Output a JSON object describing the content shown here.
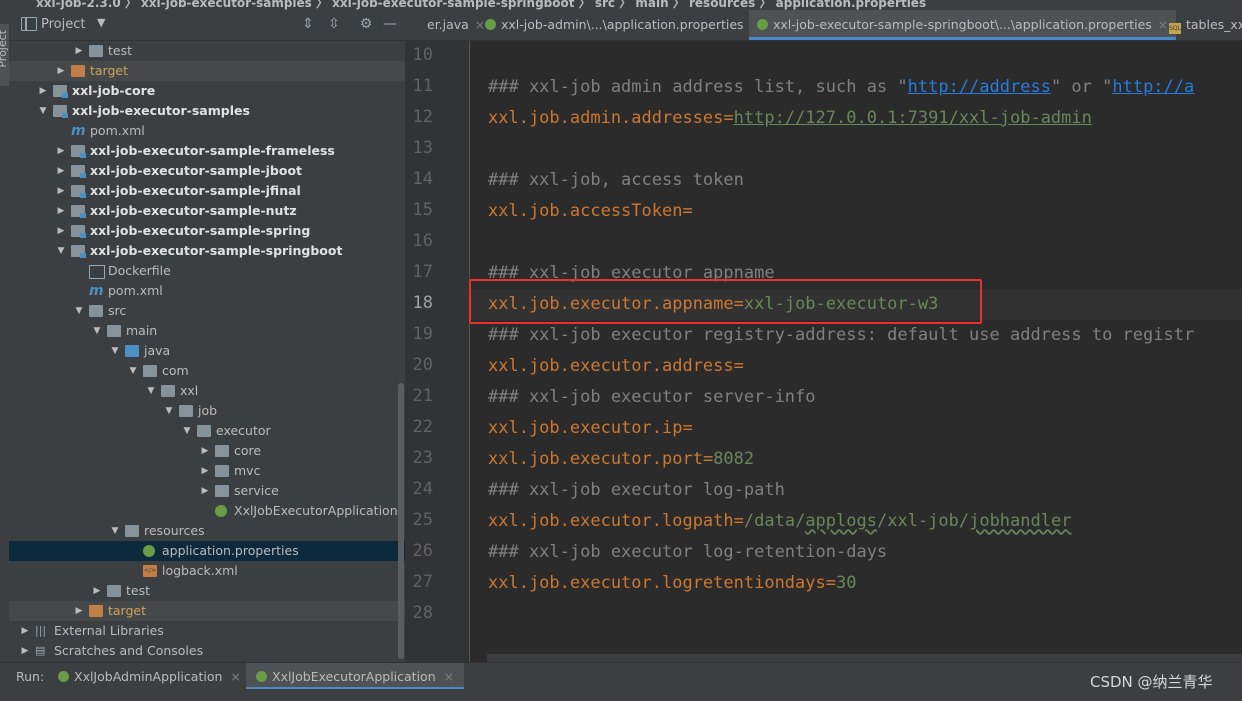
{
  "top_breadcrumb": "xxl-job-2.3.0  〉 xxl-job-executor-samples 〉 xxl-job-executor-sample-springboot 〉 src 〉 main 〉 resources 〉 application.properties",
  "left_tool": {
    "label": "Project"
  },
  "project_panel": {
    "title": "Project",
    "caret": "▼",
    "tree": [
      {
        "label": "test",
        "depth": 3,
        "tri": "▶",
        "icon": "folder",
        "style": "normal"
      },
      {
        "label": "target",
        "depth": 2,
        "tri": "▶",
        "icon": "folder-orange",
        "style": "orange",
        "dim": true
      },
      {
        "label": "xxl-job-core",
        "depth": 1,
        "tri": "▶",
        "icon": "module",
        "style": "bold"
      },
      {
        "label": "xxl-job-executor-samples",
        "depth": 1,
        "tri": "▼",
        "icon": "module",
        "style": "bold"
      },
      {
        "label": "pom.xml",
        "depth": 2,
        "tri": "",
        "icon": "maven",
        "style": "normal"
      },
      {
        "label": "xxl-job-executor-sample-frameless",
        "depth": 2,
        "tri": "▶",
        "icon": "module",
        "style": "bold"
      },
      {
        "label": "xxl-job-executor-sample-jboot",
        "depth": 2,
        "tri": "▶",
        "icon": "module",
        "style": "bold"
      },
      {
        "label": "xxl-job-executor-sample-jfinal",
        "depth": 2,
        "tri": "▶",
        "icon": "module",
        "style": "bold"
      },
      {
        "label": "xxl-job-executor-sample-nutz",
        "depth": 2,
        "tri": "▶",
        "icon": "module",
        "style": "bold"
      },
      {
        "label": "xxl-job-executor-sample-spring",
        "depth": 2,
        "tri": "▶",
        "icon": "module",
        "style": "bold"
      },
      {
        "label": "xxl-job-executor-sample-springboot",
        "depth": 2,
        "tri": "▼",
        "icon": "module",
        "style": "bold"
      },
      {
        "label": "Dockerfile",
        "depth": 3,
        "tri": "",
        "icon": "docker",
        "style": "normal"
      },
      {
        "label": "pom.xml",
        "depth": 3,
        "tri": "",
        "icon": "maven",
        "style": "normal"
      },
      {
        "label": "src",
        "depth": 3,
        "tri": "▼",
        "icon": "folder",
        "style": "normal"
      },
      {
        "label": "main",
        "depth": 4,
        "tri": "▼",
        "icon": "folder",
        "style": "normal"
      },
      {
        "label": "java",
        "depth": 5,
        "tri": "▼",
        "icon": "folder-blue",
        "style": "normal"
      },
      {
        "label": "com",
        "depth": 6,
        "tri": "▼",
        "icon": "package",
        "style": "normal"
      },
      {
        "label": "xxl",
        "depth": 7,
        "tri": "▼",
        "icon": "package",
        "style": "normal"
      },
      {
        "label": "job",
        "depth": 8,
        "tri": "▼",
        "icon": "package",
        "style": "normal"
      },
      {
        "label": "executor",
        "depth": 9,
        "tri": "▼",
        "icon": "package",
        "style": "normal"
      },
      {
        "label": "core",
        "depth": 10,
        "tri": "▶",
        "icon": "package",
        "style": "normal"
      },
      {
        "label": "mvc",
        "depth": 10,
        "tri": "▶",
        "icon": "package",
        "style": "normal"
      },
      {
        "label": "service",
        "depth": 10,
        "tri": "▶",
        "icon": "package",
        "style": "normal"
      },
      {
        "label": "XxlJobExecutorApplication",
        "depth": 10,
        "tri": "",
        "icon": "spring",
        "style": "normal"
      },
      {
        "label": "resources",
        "depth": 5,
        "tri": "▼",
        "icon": "resources",
        "style": "normal"
      },
      {
        "label": "application.properties",
        "depth": 6,
        "tri": "",
        "icon": "spring",
        "style": "normal",
        "selected": true
      },
      {
        "label": "logback.xml",
        "depth": 6,
        "tri": "",
        "icon": "xml",
        "style": "normal"
      },
      {
        "label": "test",
        "depth": 4,
        "tri": "▶",
        "icon": "folder",
        "style": "normal"
      },
      {
        "label": "target",
        "depth": 3,
        "tri": "▶",
        "icon": "folder-orange",
        "style": "orange",
        "dim": true
      },
      {
        "label": "External Libraries",
        "depth": 0,
        "tri": "▶",
        "icon": "library",
        "style": "normal"
      },
      {
        "label": "Scratches and Consoles",
        "depth": 0,
        "tri": "▶",
        "icon": "scratch",
        "style": "normal"
      }
    ]
  },
  "editor_tabs": [
    {
      "label": "er.java",
      "icon": "none",
      "active": false
    },
    {
      "label": "xxl-job-admin\\...\\application.properties",
      "icon": "spring",
      "active": false
    },
    {
      "label": "xxl-job-executor-sample-springboot\\...\\application.properties",
      "icon": "spring",
      "active": true
    },
    {
      "label": "tables_xxl_",
      "icon": "sql",
      "active": false
    }
  ],
  "code_lines": [
    {
      "n": "10",
      "segs": []
    },
    {
      "n": "11",
      "segs": [
        {
          "t": "### xxl-job admin address list, such as \"",
          "c": "cmt"
        },
        {
          "t": "http://address",
          "c": "url-c"
        },
        {
          "t": "\" or \"",
          "c": "cmt"
        },
        {
          "t": "http://a",
          "c": "url-c"
        }
      ]
    },
    {
      "n": "12",
      "segs": [
        {
          "t": "xxl.job.admin.addresses",
          "c": "key"
        },
        {
          "t": "=",
          "c": "eq"
        },
        {
          "t": "http://127.0.0.1:7391/xxl-job-admin",
          "c": "urlg"
        }
      ]
    },
    {
      "n": "13",
      "segs": []
    },
    {
      "n": "14",
      "segs": [
        {
          "t": "### xxl-job, access token",
          "c": "cmt"
        }
      ]
    },
    {
      "n": "15",
      "segs": [
        {
          "t": "xxl.job.accessToken",
          "c": "key"
        },
        {
          "t": "=",
          "c": "eq"
        }
      ]
    },
    {
      "n": "16",
      "segs": []
    },
    {
      "n": "17",
      "segs": [
        {
          "t": "### xxl-job executor appname",
          "c": "cmt"
        }
      ]
    },
    {
      "n": "18",
      "segs": [
        {
          "t": "xxl.job.executor.appname",
          "c": "key"
        },
        {
          "t": "=",
          "c": "eq"
        },
        {
          "t": "xxl-job-executor-w3",
          "c": "val"
        }
      ],
      "current": true
    },
    {
      "n": "19",
      "segs": [
        {
          "t": "### xxl-job executor registry-address: default use address to registr",
          "c": "cmt"
        }
      ]
    },
    {
      "n": "20",
      "segs": [
        {
          "t": "xxl.job.executor.address",
          "c": "key"
        },
        {
          "t": "=",
          "c": "eq"
        }
      ]
    },
    {
      "n": "21",
      "segs": [
        {
          "t": "### xxl-job executor server-info",
          "c": "cmt"
        }
      ]
    },
    {
      "n": "22",
      "segs": [
        {
          "t": "xxl.job.executor.ip",
          "c": "key"
        },
        {
          "t": "=",
          "c": "eq"
        }
      ]
    },
    {
      "n": "23",
      "segs": [
        {
          "t": "xxl.job.executor.port",
          "c": "key"
        },
        {
          "t": "=",
          "c": "eq"
        },
        {
          "t": "8082",
          "c": "val"
        }
      ]
    },
    {
      "n": "24",
      "segs": [
        {
          "t": "### xxl-job executor log-path",
          "c": "cmt"
        }
      ]
    },
    {
      "n": "25",
      "segs": [
        {
          "t": "xxl.job.executor.logpath",
          "c": "key"
        },
        {
          "t": "=",
          "c": "eq"
        },
        {
          "t": "/data/",
          "c": "val"
        },
        {
          "t": "applogs",
          "c": "val-wavy"
        },
        {
          "t": "/xxl-job/",
          "c": "val"
        },
        {
          "t": "jobhandler",
          "c": "val-wavy"
        }
      ]
    },
    {
      "n": "26",
      "segs": [
        {
          "t": "### xxl-job executor log-retention-days",
          "c": "cmt"
        }
      ]
    },
    {
      "n": "27",
      "segs": [
        {
          "t": "xxl.job.executor.logretentiondays",
          "c": "key"
        },
        {
          "t": "=",
          "c": "eq"
        },
        {
          "t": "30",
          "c": "val"
        }
      ]
    },
    {
      "n": "28",
      "segs": []
    }
  ],
  "run_bar": {
    "label": "Run:",
    "tabs": [
      {
        "label": "XxlJobAdminApplication",
        "active": false
      },
      {
        "label": "XxlJobExecutorApplication",
        "active": true
      }
    ],
    "close": "×"
  },
  "watermark": "CSDN @纳兰青华",
  "colors": {
    "accent": "#4a88c7",
    "highlight_box": "#e8302c",
    "key": "#cc7832",
    "value": "#6a8759",
    "comment": "#808080"
  }
}
